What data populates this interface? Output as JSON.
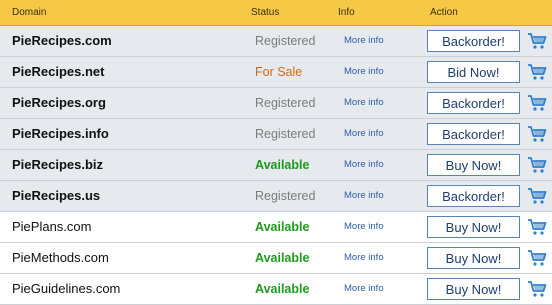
{
  "header": {
    "domain": "Domain",
    "status": "Status",
    "info": "Info",
    "action": "Action"
  },
  "colors": {
    "header_bg": "#f5c845",
    "registered": "#7c7c7c",
    "for_sale": "#d46a13",
    "available": "#1e9a1e",
    "link": "#2d5fa6",
    "button_border": "#5b83b3",
    "cart": "#2f7fcc"
  },
  "rows": [
    {
      "domain": "PieRecipes.com",
      "status": "Registered",
      "info": "More info",
      "action": "Backorder!",
      "icon": "cart-icon"
    },
    {
      "domain": "PieRecipes.net",
      "status": "For Sale",
      "info": "More info",
      "action": "Bid Now!",
      "icon": "cart-icon"
    },
    {
      "domain": "PieRecipes.org",
      "status": "Registered",
      "info": "More info",
      "action": "Backorder!",
      "icon": "cart-icon"
    },
    {
      "domain": "PieRecipes.info",
      "status": "Registered",
      "info": "More info",
      "action": "Backorder!",
      "icon": "cart-icon"
    },
    {
      "domain": "PieRecipes.biz",
      "status": "Available",
      "info": "More info",
      "action": "Buy Now!",
      "icon": "cart-icon"
    },
    {
      "domain": "PieRecipes.us",
      "status": "Registered",
      "info": "More info",
      "action": "Backorder!",
      "icon": "cart-icon"
    },
    {
      "domain": "PiePlans.com",
      "status": "Available",
      "info": "More info",
      "action": "Buy Now!",
      "icon": "cart-icon"
    },
    {
      "domain": "PieMethods.com",
      "status": "Available",
      "info": "More info",
      "action": "Buy Now!",
      "icon": "cart-icon"
    },
    {
      "domain": "PieGuidelines.com",
      "status": "Available",
      "info": "More info",
      "action": "Buy Now!",
      "icon": "cart-icon"
    }
  ]
}
